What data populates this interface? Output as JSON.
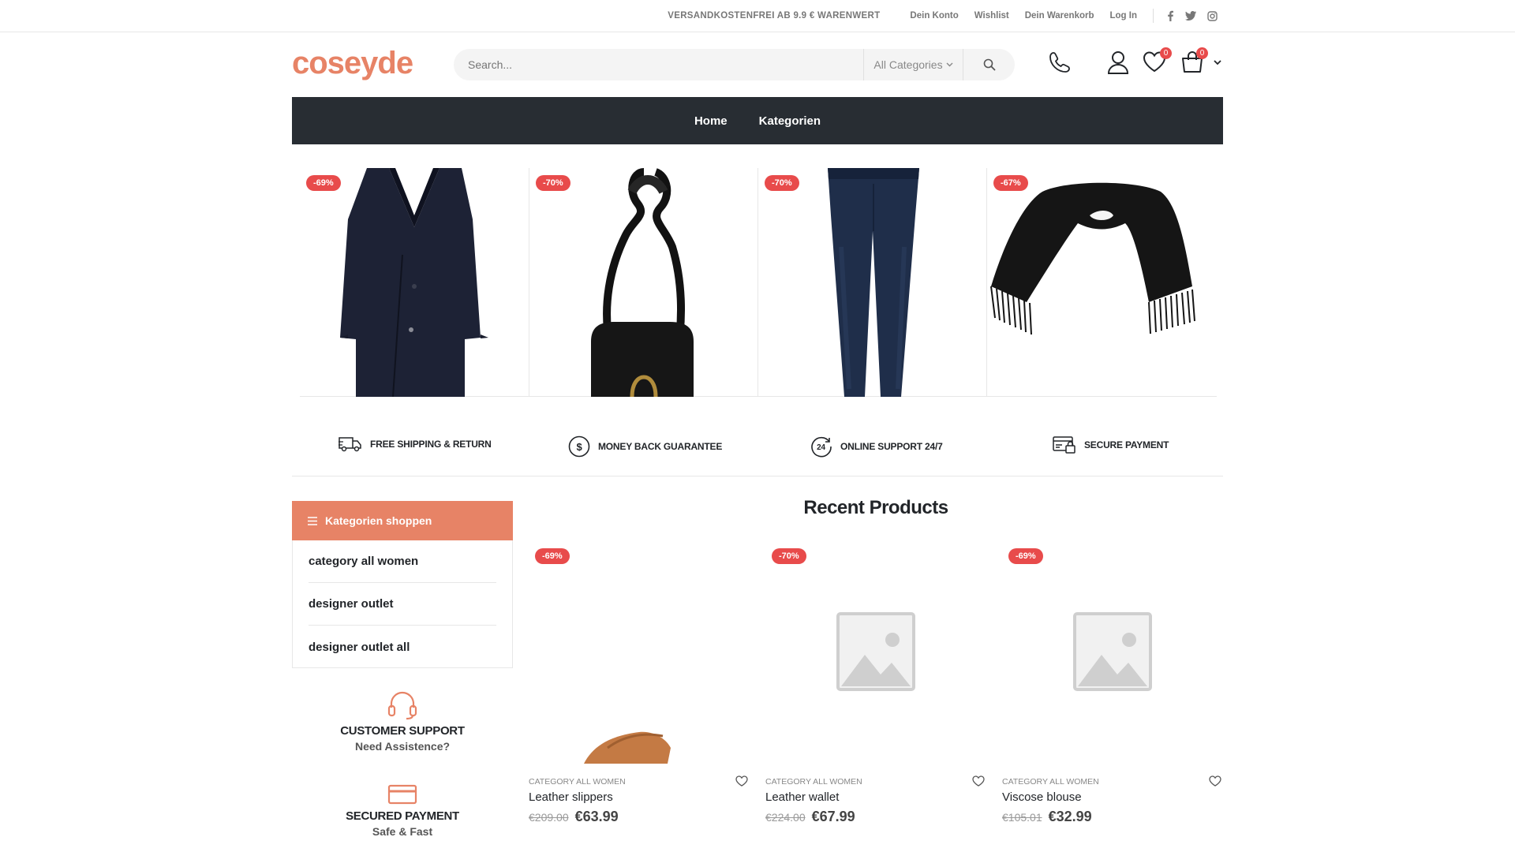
{
  "topbar": {
    "promo": "VERSANDKOSTENFREI AB 9.9 € WARENWERT",
    "links": [
      "Dein Konto",
      "Wishlist",
      "Dein Warenkorb",
      "Log In"
    ],
    "social": [
      "facebook-icon",
      "twitter-icon",
      "instagram-icon"
    ]
  },
  "header": {
    "logo": "coseyde",
    "search_placeholder": "Search...",
    "category_select": "All Categories",
    "wishlist_count": "0",
    "cart_count": "0"
  },
  "nav": {
    "items": [
      "Home",
      "Kategorien"
    ]
  },
  "hero": {
    "products": [
      {
        "discount": "-69%",
        "image": "coat"
      },
      {
        "discount": "-70%",
        "image": "bag"
      },
      {
        "discount": "-70%",
        "image": "jeans"
      },
      {
        "discount": "-67%",
        "image": "scarf"
      }
    ]
  },
  "features": [
    {
      "label": "FREE SHIPPING & RETURN",
      "icon": "truck-icon"
    },
    {
      "label": "MONEY BACK GUARANTEE",
      "icon": "dollar-circle-icon"
    },
    {
      "label": "ONLINE SUPPORT 24/7",
      "icon": "support-24-icon"
    },
    {
      "label": "SECURE PAYMENT",
      "icon": "secure-payment-icon"
    }
  ],
  "sidebar": {
    "header": "Kategorien shoppen",
    "categories": [
      "category all women",
      "designer outlet",
      "designer outlet all"
    ],
    "info": [
      {
        "title": "CUSTOMER SUPPORT",
        "subtitle": "Need Assistence?",
        "icon": "headset-icon"
      },
      {
        "title": "SECURED PAYMENT",
        "subtitle": "Safe & Fast",
        "icon": "credit-card-icon"
      }
    ]
  },
  "recent": {
    "title": "Recent Products",
    "products": [
      {
        "discount": "-69%",
        "category": "CATEGORY ALL WOMEN",
        "name": "Leather slippers",
        "old_price": "€209.00",
        "price": "€63.99"
      },
      {
        "discount": "-70%",
        "category": "CATEGORY ALL WOMEN",
        "name": "Leather wallet",
        "old_price": "€224.00",
        "price": "€67.99"
      },
      {
        "discount": "-69%",
        "category": "CATEGORY ALL WOMEN",
        "name": "Viscose blouse",
        "old_price": "€105.01",
        "price": "€32.99"
      }
    ]
  },
  "colors": {
    "accent": "#e78366",
    "nav": "#282d33",
    "badge": "#e84b4b"
  }
}
